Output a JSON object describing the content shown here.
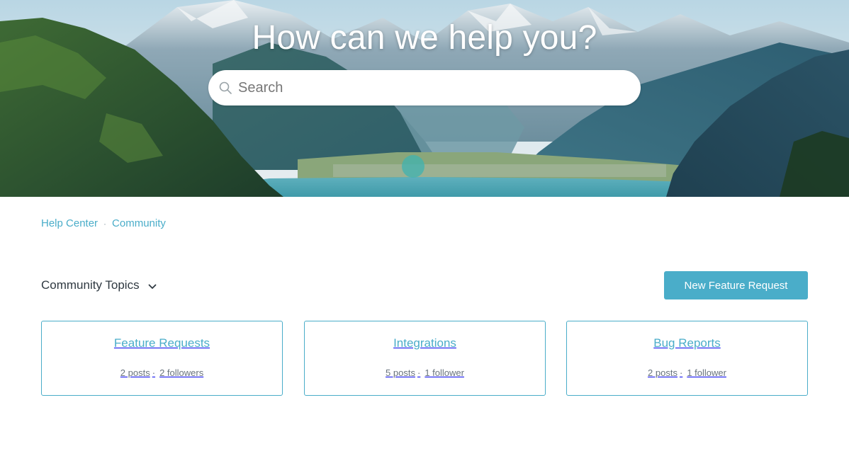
{
  "hero": {
    "title": "How can we help you?",
    "search_placeholder": "Search"
  },
  "breadcrumb": {
    "items": [
      "Help Center",
      "Community"
    ],
    "separator": "·"
  },
  "topics": {
    "heading": "Community Topics",
    "new_request_label": "New Feature Request"
  },
  "cards": [
    {
      "title": "Feature Requests",
      "posts": "2 posts",
      "followers": "2 followers"
    },
    {
      "title": "Integrations",
      "posts": "5 posts",
      "followers": "1 follower"
    },
    {
      "title": "Bug Reports",
      "posts": "2 posts",
      "followers": "1 follower"
    }
  ],
  "meta_separator": "·",
  "colors": {
    "accent": "#4aadc9",
    "text_dark": "#2f3941",
    "text_muted": "#68737d"
  },
  "icons": [
    "search-icon",
    "chevron-down-icon"
  ]
}
